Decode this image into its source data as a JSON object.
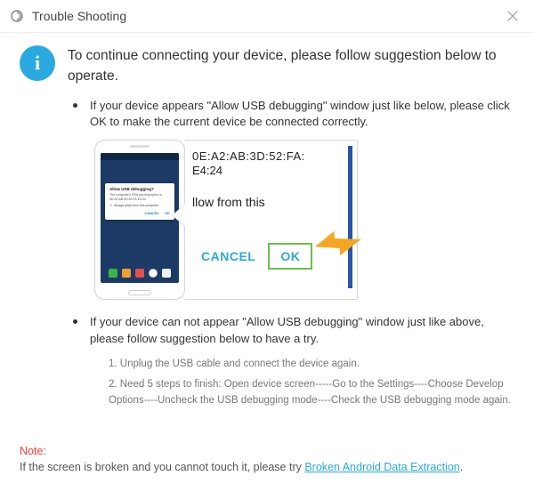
{
  "titlebar": {
    "title": "Trouble Shooting"
  },
  "lead": "To continue connecting your device, please follow suggestion below to operate.",
  "bullet1": "If your device appears \"Allow USB debugging\" window just like below, please click OK to make the current device  be connected correctly.",
  "bullet2": "If your device can not appear \"Allow USB debugging\" window just like above, please follow suggestion below to have a try.",
  "phone_popup": {
    "title": "Allow USB debugging?",
    "body": "The computer's RSA key fingerprint is: 0E:A2:AB:3D:52:FA:E4:24",
    "check": "Always allow from this computer",
    "cancel": "CANCEL",
    "ok": "OK"
  },
  "crop": {
    "line1": "0E:A2:AB:3D:52:FA:",
    "line2": "E4:24",
    "line3": "llow from this",
    "cancel": "CANCEL",
    "ok": "OK"
  },
  "steps": {
    "s1": "1. Unplug the USB cable and connect the device again.",
    "s2": "2. Need 5 steps to finish: Open device screen-----Go to the Settings----Choose Develop Options----Uncheck the USB debugging mode----Check the USB debugging mode again."
  },
  "note": {
    "label": "Note:",
    "text": "If the screen is broken and you cannot touch it, please try ",
    "link": "Broken Android Data Extraction",
    "tail": "."
  }
}
